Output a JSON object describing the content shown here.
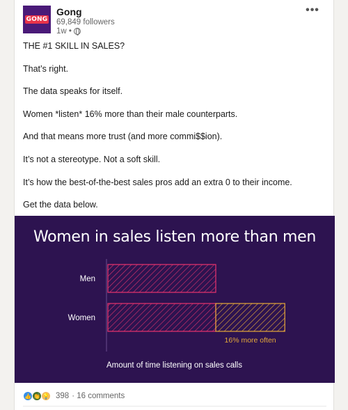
{
  "post": {
    "author": "Gong",
    "logo_text": "GONG",
    "followers": "69,849 followers",
    "time": "1w •",
    "paragraphs": [
      "THE #1 SKILL IN SALES?",
      "That’s right.",
      "The data speaks for itself.",
      "Women *listen* 16% more than their male counterparts.",
      "And that means more trust (and more commi$$ion).",
      "It’s not a stereotype. Not a soft skill.",
      "It’s how the best-of-the-best sales pros add an extra 0 to their income.",
      "Get the data below."
    ],
    "more_menu": "•••"
  },
  "colors": {
    "background": "#2d1350",
    "bar_stroke": "#e8336d",
    "extra_stroke": "#e6a93a",
    "axis": "#6a4c8f"
  },
  "chart_data": {
    "type": "bar",
    "orientation": "horizontal",
    "title": "Women in sales listen more than men",
    "xlabel": "Amount of time listening on sales calls",
    "categories": [
      "Men",
      "Women"
    ],
    "values": [
      1.0,
      1.16
    ],
    "annotation": "16% more often",
    "xlim": [
      0,
      1.4
    ]
  },
  "engagement": {
    "reaction_count": "398",
    "comments": "· 16 comments"
  }
}
